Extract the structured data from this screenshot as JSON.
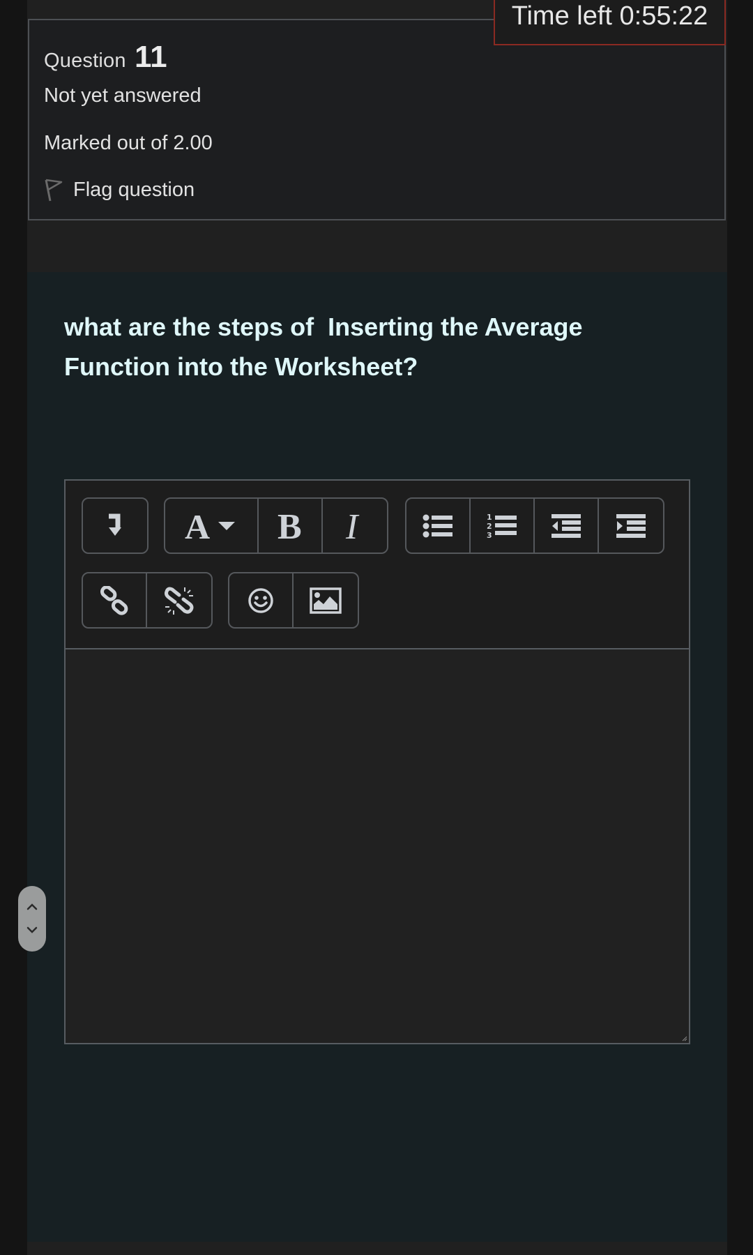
{
  "timer": {
    "label": "Time left 0:55:22"
  },
  "question_info": {
    "prefix": "Question",
    "number": "11",
    "state": "Not yet answered",
    "marks": "Marked out of 2.00",
    "flag_label": "Flag question"
  },
  "question": {
    "text": "what are the steps of  Inserting the Average\nFunction into the Worksheet?"
  },
  "editor": {
    "value": "",
    "toolbar": [
      {
        "group": "show-more",
        "buttons": [
          {
            "name": "show-more-buttons",
            "icon": "arrow-down-icon"
          }
        ]
      },
      {
        "group": "style",
        "buttons": [
          {
            "name": "paragraph-styles",
            "icon": "font-dropdown-icon"
          },
          {
            "name": "bold",
            "icon": "bold-icon"
          },
          {
            "name": "italic",
            "icon": "italic-icon"
          }
        ]
      },
      {
        "group": "list",
        "buttons": [
          {
            "name": "unordered-list",
            "icon": "bullet-list-icon"
          },
          {
            "name": "ordered-list",
            "icon": "numbered-list-icon"
          },
          {
            "name": "outdent",
            "icon": "outdent-icon"
          },
          {
            "name": "indent",
            "icon": "indent-icon"
          }
        ]
      },
      {
        "group": "links",
        "buttons": [
          {
            "name": "link",
            "icon": "link-icon"
          },
          {
            "name": "unlink",
            "icon": "unlink-icon"
          }
        ]
      },
      {
        "group": "insert",
        "buttons": [
          {
            "name": "emoticon",
            "icon": "smiley-icon"
          },
          {
            "name": "image",
            "icon": "image-icon"
          }
        ]
      }
    ]
  },
  "colors": {
    "timer_border": "#8b2a22",
    "question_text": "#dff7f9",
    "question_panel": "#172023"
  }
}
